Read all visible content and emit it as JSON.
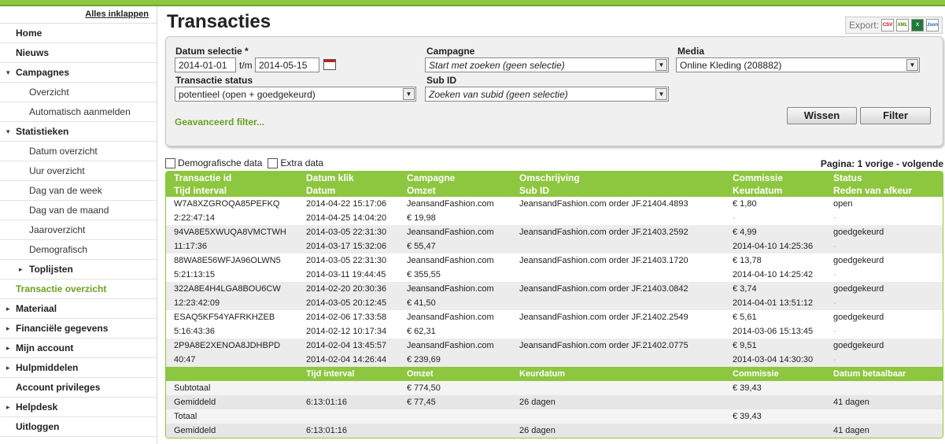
{
  "sidebar": {
    "collapse_all": "Alles inklappen",
    "items": [
      {
        "label": "Home",
        "level": "top"
      },
      {
        "label": "Nieuws",
        "level": "top"
      },
      {
        "label": "Campagnes",
        "level": "top",
        "arrow": "▾"
      },
      {
        "label": "Overzicht",
        "level": "sub"
      },
      {
        "label": "Automatisch aanmelden",
        "level": "sub"
      },
      {
        "label": "Statistieken",
        "level": "top",
        "arrow": "▾"
      },
      {
        "label": "Datum overzicht",
        "level": "sub"
      },
      {
        "label": "Uur overzicht",
        "level": "sub"
      },
      {
        "label": "Dag van de week",
        "level": "sub"
      },
      {
        "label": "Dag van de maand",
        "level": "sub"
      },
      {
        "label": "Jaaroverzicht",
        "level": "sub"
      },
      {
        "label": "Demografisch",
        "level": "sub"
      },
      {
        "label": "Toplijsten",
        "level": "subsub",
        "arrow": "▸"
      },
      {
        "label": "Transactie overzicht",
        "level": "active"
      },
      {
        "label": "Materiaal",
        "level": "top",
        "arrow": "▸"
      },
      {
        "label": "Financiële gegevens",
        "level": "top",
        "arrow": "▸"
      },
      {
        "label": "Mijn account",
        "level": "top",
        "arrow": "▸"
      },
      {
        "label": "Hulpmiddelen",
        "level": "top",
        "arrow": "▸"
      },
      {
        "label": "Account privileges",
        "level": "top"
      },
      {
        "label": "Helpdesk",
        "level": "top",
        "arrow": "▸"
      },
      {
        "label": "Uitloggen",
        "level": "top"
      }
    ]
  },
  "page": {
    "title": "Transacties",
    "export_label": "Export:",
    "export_icons": [
      "CSV",
      "XML",
      "X",
      "Json"
    ]
  },
  "filter": {
    "datum_label": "Datum selectie *",
    "date_from": "2014-01-01",
    "tm": "t/m",
    "date_to": "2014-05-15",
    "campagne_label": "Campagne",
    "campagne_value": "Start met zoeken (geen selectie)",
    "media_label": "Media",
    "media_value": "Online Kleding (208882)",
    "status_label": "Transactie status",
    "status_value": "potentieel (open + goedgekeurd)",
    "subid_label": "Sub ID",
    "subid_value": "Zoeken van subid (geen selectie)",
    "advanced": "Geavanceerd filter...",
    "clear_button": "Wissen",
    "filter_button": "Filter"
  },
  "options": {
    "demografische": "Demografische data",
    "extra": "Extra data"
  },
  "pager": {
    "label": "Pagina:",
    "page": "1",
    "prev": "vorige",
    "sep": "-",
    "next": "volgende"
  },
  "table": {
    "headers1": [
      "Transactie id",
      "Datum klik",
      "Campagne",
      "Omschrijving",
      "Commissie",
      "Status"
    ],
    "headers2": [
      "Tijd interval",
      "Datum",
      "Omzet",
      "Sub ID",
      "Keurdatum",
      "Reden van afkeur"
    ],
    "rows": [
      {
        "a": [
          "W7A8XZGROQA85PEFKQ",
          "2014-04-22 15:17:06",
          "JeansandFashion.com",
          "JeansandFashion.com order JF.21404.4893",
          "€ 1,80",
          "open"
        ],
        "b": [
          "2:22:47:14",
          "2014-04-25 14:04:20",
          "€ 19,98",
          "",
          "-",
          "-"
        ]
      },
      {
        "a": [
          "94VA8E5XWUQA8VMCTWH",
          "2014-03-05 22:31:30",
          "JeansandFashion.com",
          "JeansandFashion.com order JF.21403.2592",
          "€ 4,99",
          "goedgekeurd"
        ],
        "b": [
          "11:17:36",
          "2014-03-17 15:32:06",
          "€ 55,47",
          "",
          "2014-04-10 14:25:36",
          "-"
        ]
      },
      {
        "a": [
          "88WA8E56WFJA96OLWN5",
          "2014-03-05 22:31:30",
          "JeansandFashion.com",
          "JeansandFashion.com order JF.21403.1720",
          "€ 13,78",
          "goedgekeurd"
        ],
        "b": [
          "5:21:13:15",
          "2014-03-11 19:44:45",
          "€ 355,55",
          "",
          "2014-04-10 14:25:42",
          "-"
        ]
      },
      {
        "a": [
          "322A8E4H4LGA8BOU6CW",
          "2014-02-20 20:30:36",
          "JeansandFashion.com",
          "JeansandFashion.com order JF.21403.0842",
          "€ 3,74",
          "goedgekeurd"
        ],
        "b": [
          "12:23:42:09",
          "2014-03-05 20:12:45",
          "€ 41,50",
          "",
          "2014-04-01 13:51:12",
          "-"
        ]
      },
      {
        "a": [
          "ESAQ5KF54YAFRKHZEB",
          "2014-02-06 17:33:58",
          "JeansandFashion.com",
          "JeansandFashion.com order JF.21402.2549",
          "€ 5,61",
          "goedgekeurd"
        ],
        "b": [
          "5:16:43:36",
          "2014-02-12 10:17:34",
          "€ 62,31",
          "",
          "2014-03-06 15:13:45",
          "-"
        ]
      },
      {
        "a": [
          "2P9A8E2XENOA8JDHBPD",
          "2014-02-04 13:45:57",
          "JeansandFashion.com",
          "JeansandFashion.com order JF.21402.0775",
          "€ 9,51",
          "goedgekeurd"
        ],
        "b": [
          "40:47",
          "2014-02-04 14:26:44",
          "€ 239,69",
          "",
          "2014-03-04 14:30:30",
          "-"
        ]
      }
    ],
    "summary_head": [
      "",
      "Tijd interval",
      "Omzet",
      "Keurdatum",
      "Commissie",
      "Datum betaalbaar"
    ],
    "summary": [
      [
        "Subtotaal",
        "",
        "€ 774,50",
        "",
        "€ 39,43",
        ""
      ],
      [
        "Gemiddeld",
        "6:13:01:16",
        "€ 77,45",
        "26 dagen",
        "",
        "41 dagen"
      ],
      [
        "Totaal",
        "",
        "",
        "",
        "€ 39,43",
        ""
      ],
      [
        "Gemiddeld",
        "6:13:01:16",
        "",
        "26 dagen",
        "",
        "41 dagen"
      ]
    ]
  },
  "colors": {
    "accent": "#8dc63f",
    "active_link": "#6aa121"
  }
}
